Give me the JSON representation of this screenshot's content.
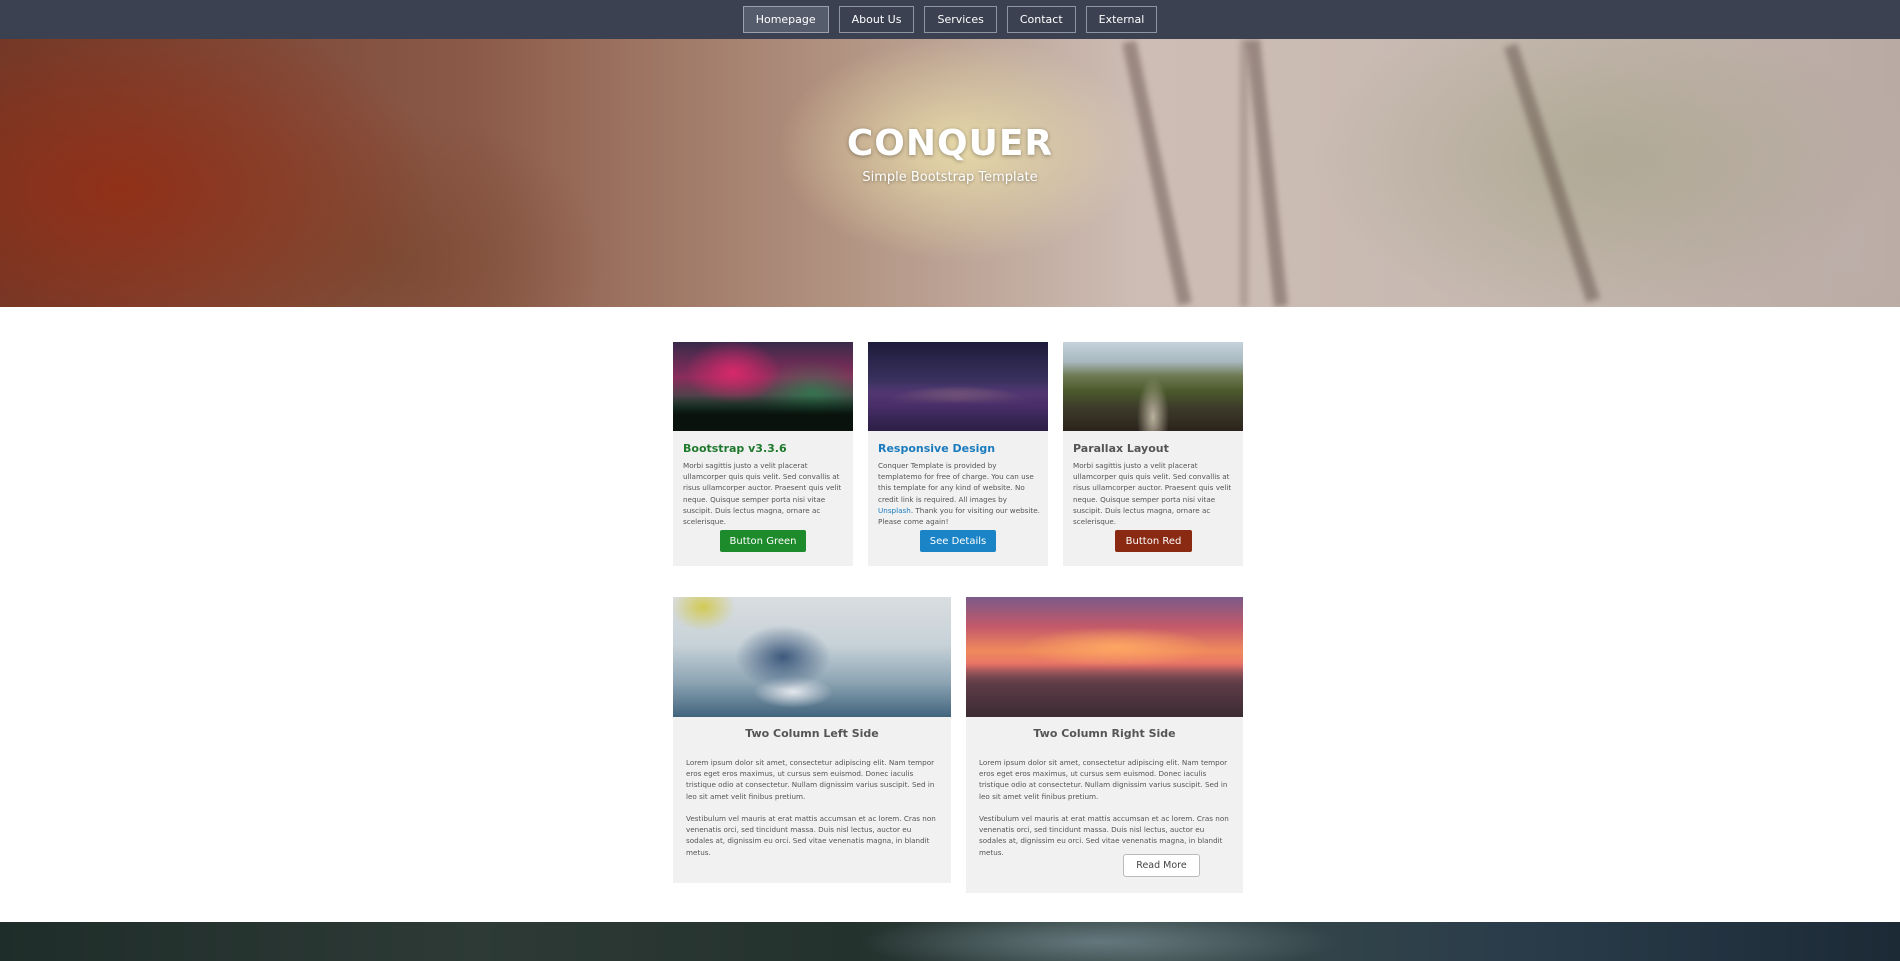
{
  "nav": {
    "items": [
      {
        "label": "Homepage",
        "active": true
      },
      {
        "label": "About Us",
        "active": false
      },
      {
        "label": "Services",
        "active": false
      },
      {
        "label": "Contact",
        "active": false
      },
      {
        "label": "External",
        "active": false
      }
    ]
  },
  "hero": {
    "title": "CONQUER",
    "subtitle": "Simple Bootstrap Template"
  },
  "cards": [
    {
      "title": "Bootstrap v3.3.6",
      "title_color": "#1f7a2e",
      "text": "Morbi sagittis justo a velit placerat ullamcorper quis quis velit. Sed convallis at risus ullamcorper auctor. Praesent quis velit neque. Quisque semper porta nisi vitae suscipit. Duis lectus magna, ornare ac scelerisque.",
      "button": "Button Green",
      "button_color": "#1d8a2c"
    },
    {
      "title": "Responsive Design",
      "title_color": "#1a7bbd",
      "text_before_link": "Conquer Template is provided by templatemo for free of charge. You can use this template for any kind of website. No credit link is required. All images by ",
      "link": "Unsplash",
      "text_after_link": ". Thank you for visiting our website. Please come again!",
      "button": "See Details",
      "button_color": "#1a84c6"
    },
    {
      "title": "Parallax Layout",
      "title_color": "#555555",
      "text": "Morbi sagittis justo a velit placerat ullamcorper quis quis velit. Sed convallis at risus ullamcorper auctor. Praesent quis velit neque. Quisque semper porta nisi vitae suscipit. Duis lectus magna, ornare ac scelerisque.",
      "button": "Button Red",
      "button_color": "#8a2a12"
    }
  ],
  "columns": [
    {
      "title": "Two Column Left Side",
      "p1": "Lorem ipsum dolor sit amet, consectetur adipiscing elit. Nam tempor eros eget eros maximus, ut cursus sem euismod. Donec iaculis tristique odio at consectetur. Nullam dignissim varius suscipit. Sed in leo sit amet velit finibus pretium.",
      "p2": "Vestibulum vel mauris at erat mattis accumsan et ac lorem. Cras non venenatis orci, sed tincidunt massa. Duis nisl lectus, auctor eu sodales at, dignissim eu orci. Sed vitae venenatis magna, in blandit metus."
    },
    {
      "title": "Two Column Right Side",
      "p1": "Lorem ipsum dolor sit amet, consectetur adipiscing elit. Nam tempor eros eget eros maximus, ut cursus sem euismod. Donec iaculis tristique odio at consectetur. Nullam dignissim varius suscipit. Sed in leo sit amet velit finibus pretium.",
      "p2": "Vestibulum vel mauris at erat mattis accumsan et ac lorem. Cras non venenatis orci, sed tincidunt massa. Duis nisl lectus, auctor eu sodales at, dignissim eu orci. Sed vitae venenatis magna, in blandit metus.",
      "button": "Read More"
    }
  ]
}
